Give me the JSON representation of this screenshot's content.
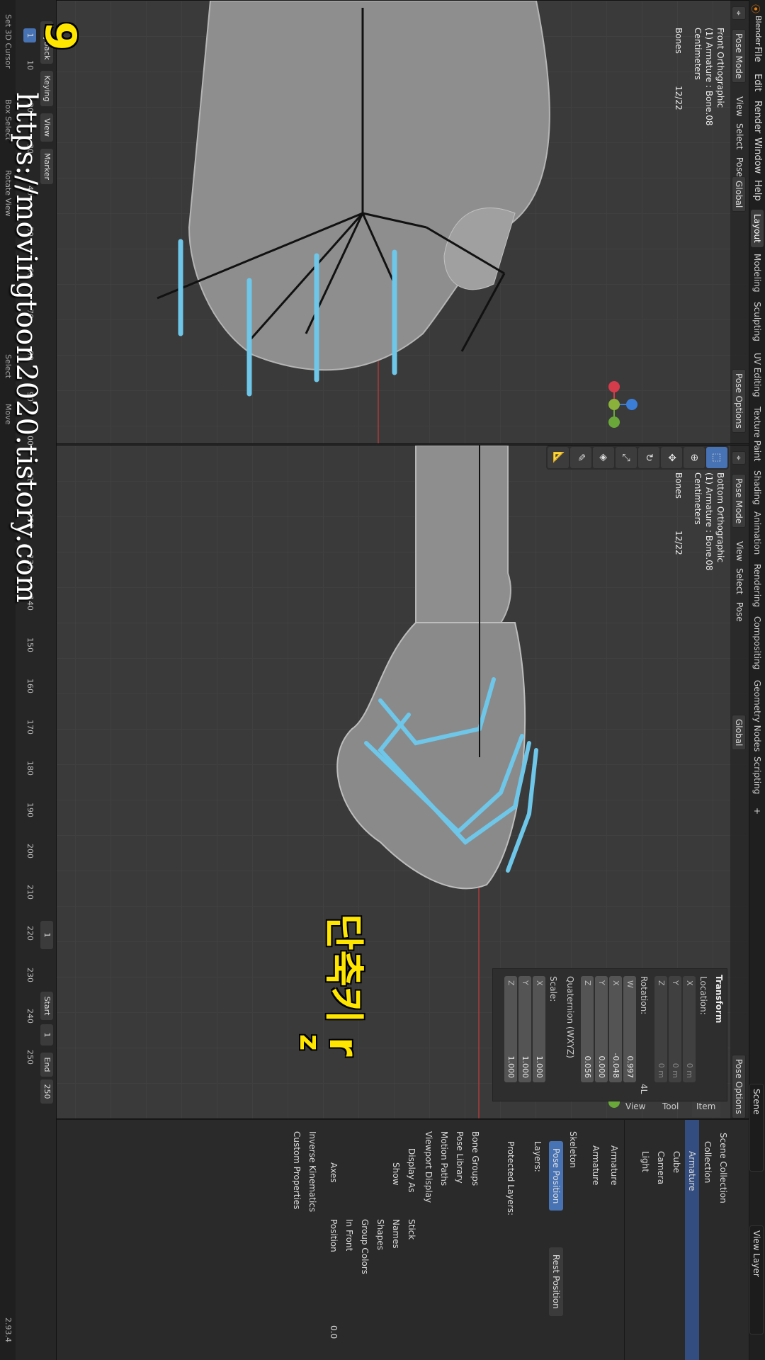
{
  "app": {
    "name": "Blender",
    "version": "2.93.4"
  },
  "menus": [
    "File",
    "Edit",
    "Render",
    "Window",
    "Help"
  ],
  "workspaces": [
    "Layout",
    "Modeling",
    "Sculpting",
    "UV Editing",
    "Texture Paint",
    "Shading",
    "Animation",
    "Rendering",
    "Compositing",
    "Geometry Nodes",
    "Scripting"
  ],
  "scene_label": "Scene",
  "view_layer_label": "View Layer",
  "viewport_top": {
    "mode": "Pose Mode",
    "menus": [
      "View",
      "Select",
      "Pose"
    ],
    "orientation": "Global",
    "pose_options": "Pose Options",
    "view_name": "Front Orthographic",
    "object": "(1) Armature : Bone.08",
    "units": "Centimeters",
    "bones_label": "Bones",
    "bones_value": "12/22"
  },
  "viewport_bottom": {
    "mode": "Pose Mode",
    "menus": [
      "View",
      "Select",
      "Pose"
    ],
    "orientation": "Global",
    "pose_options": "Pose Options",
    "view_name": "Bottom Orthographic",
    "object": "(1) Armature : Bone.08",
    "units": "Centimeters",
    "bones_label": "Bones",
    "bones_value": "12/22"
  },
  "transform": {
    "title": "Transform",
    "location_label": "Location:",
    "location": {
      "x": "0 m",
      "y": "0 m",
      "z": "0 m"
    },
    "rotation_label": "Rotation:",
    "rotation": {
      "w": "0.997",
      "x": "-0.048",
      "y": "0.000",
      "z": "0.056"
    },
    "rotation_mode": "Quaternion (WXYZ)",
    "scale_label": "Scale:",
    "scale": {
      "x": "1.000",
      "y": "1.000",
      "z": "1.000"
    },
    "axis_w": "W",
    "axis_x": "X",
    "axis_y": "Y",
    "axis_z": "Z",
    "field_4l": "4L"
  },
  "n_panel_tabs": [
    "Item",
    "Tool",
    "View"
  ],
  "outliner": {
    "scene_collection": "Scene Collection",
    "collection": "Collection",
    "armature": "Armature",
    "cube": "Cube",
    "camera": "Camera",
    "light": "Light"
  },
  "properties": {
    "armature_name": "Armature",
    "armature_data": "Armature",
    "skeleton": "Skeleton",
    "pose_position": "Pose Position",
    "rest_position": "Rest Position",
    "layers": "Layers:",
    "protected_layers": "Protected Layers:",
    "bone_groups": "Bone Groups",
    "pose_library": "Pose Library",
    "motion_paths": "Motion Paths",
    "viewport_display": "Viewport Display",
    "display_as": "Display As",
    "display_value": "Stick",
    "show": "Show",
    "names": "Names",
    "shapes": "Shapes",
    "group_colors": "Group Colors",
    "in_front": "In Front",
    "axes": "Axes",
    "position": "Position",
    "position_value": "0.0",
    "inverse_kinematics": "Inverse Kinematics",
    "custom_properties": "Custom Properties"
  },
  "timeline": {
    "playback": "Playback",
    "keying": "Keying",
    "view": "View",
    "marker": "Marker",
    "ticks": [
      "10",
      "20",
      "30",
      "40",
      "50",
      "60",
      "70",
      "80",
      "90",
      "100",
      "110",
      "120",
      "130",
      "140",
      "150",
      "160",
      "170",
      "180",
      "190",
      "200",
      "210",
      "220",
      "230",
      "240",
      "250"
    ],
    "current_frame": "1",
    "current_frame_field": "1",
    "start_label": "Start",
    "start": "1",
    "end_label": "End",
    "end": "250"
  },
  "status": {
    "set_cursor": "Set 3D Cursor",
    "box_select": "Box Select",
    "rotate_view": "Rotate View",
    "select": "Select",
    "move": "Move"
  },
  "overlay": {
    "step_number": "9",
    "shortcut_text": "단축키 r",
    "shortcut_key": "z",
    "watermark": "https://movingtoon2020.tistory.com"
  },
  "colors": {
    "accent": "#4772b3",
    "bone": "#6ec6e8",
    "overlay_yellow": "#ffe600"
  }
}
